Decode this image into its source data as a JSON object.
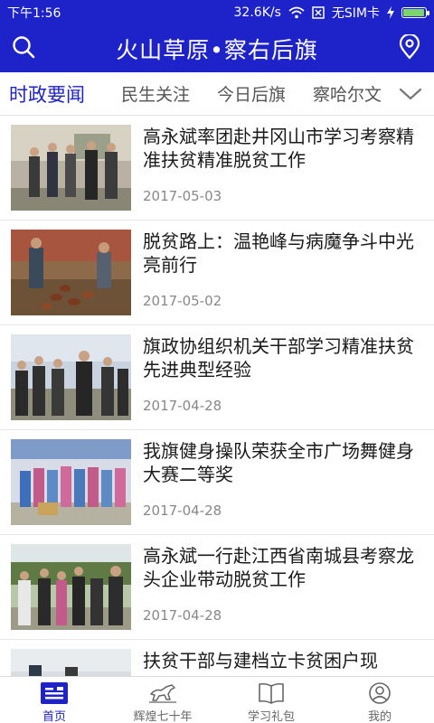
{
  "status_bar": {
    "time": "下午1:56",
    "speed": "32.6K/s",
    "sim": "无SIM卡",
    "battery_level": 1.0
  },
  "header": {
    "title": "火山草原•察右后旗",
    "search_icon": "search-icon",
    "location_icon": "location-pin-icon"
  },
  "tabs": {
    "items": [
      {
        "label": "时政要闻",
        "active": true
      },
      {
        "label": "民生关注",
        "active": false
      },
      {
        "label": "今日后旗",
        "active": false
      },
      {
        "label": "察哈尔文",
        "active": false
      }
    ],
    "more_icon": "chevron-down-icon"
  },
  "news": [
    {
      "title": "高永斌率团赴井冈山市学习考察精准扶贫精准脱贫工作",
      "date": "2017-05-03"
    },
    {
      "title": "脱贫路上：温艳峰与病魔争斗中光亮前行",
      "date": "2017-05-02"
    },
    {
      "title": "旗政协组织机关干部学习精准扶贫先进典型经验",
      "date": "2017-04-28"
    },
    {
      "title": "我旗健身操队荣获全市广场舞健身大赛二等奖",
      "date": "2017-04-28"
    },
    {
      "title": "高永斌一行赴江西省南城县考察龙头企业带动脱贫工作",
      "date": "2017-04-28"
    },
    {
      "title": "扶贫干部与建档立卡贫困户现",
      "date": ""
    }
  ],
  "bottom_nav": {
    "items": [
      {
        "label": "首页",
        "icon": "home-news-icon",
        "active": true
      },
      {
        "label": "辉煌七十年",
        "icon": "horse-icon",
        "active": false
      },
      {
        "label": "学习礼包",
        "icon": "book-icon",
        "active": false
      },
      {
        "label": "我的",
        "icon": "profile-icon",
        "active": false
      }
    ]
  },
  "colors": {
    "primary_blue": "#1e22c9",
    "text_dark": "#1a1a1a",
    "date_gray": "#888888",
    "divider": "#e6e6e6"
  }
}
